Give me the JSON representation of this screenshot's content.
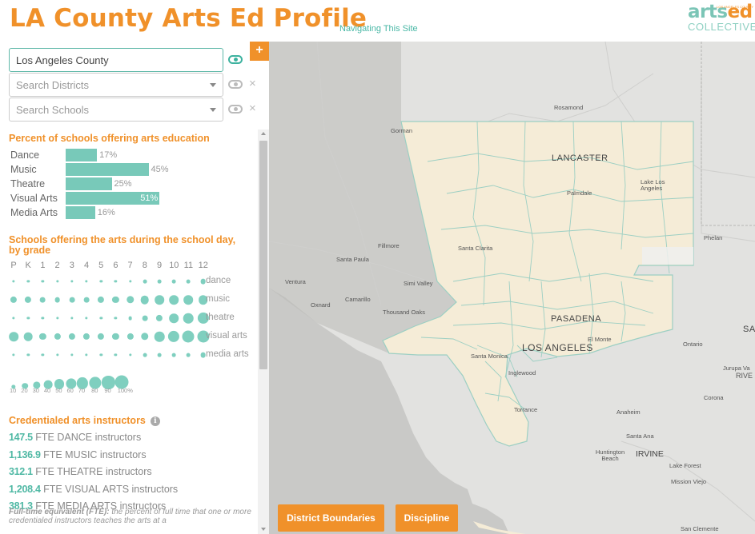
{
  "header": {
    "title": "LA County Arts Ed Profile",
    "nav_link": "Navigating This Site",
    "logo_main_1": "arts",
    "logo_main_2": "ed",
    "logo_sub": "COLLECTIVE",
    "logo_tiny": "LOS ANGELES COUNTY"
  },
  "search": {
    "county_value": "Los Angeles County",
    "districts_placeholder": "Search Districts",
    "schools_placeholder": "Search Schools",
    "add_label": "+",
    "clear_icon": "×"
  },
  "percent_section": {
    "title": "Percent of schools offering arts education",
    "rows": [
      {
        "label": "Dance",
        "value": "17%",
        "pct": 17
      },
      {
        "label": "Music",
        "value": "45%",
        "pct": 45
      },
      {
        "label": "Theatre",
        "value": "25%",
        "pct": 25
      },
      {
        "label": "Visual Arts",
        "value": "51%",
        "pct": 51
      },
      {
        "label": "Media Arts",
        "value": "16%",
        "pct": 16
      }
    ]
  },
  "grade_section": {
    "title_line1": "Schools offering the arts during the school day,",
    "title_line2": "by grade",
    "grades": [
      "P",
      "K",
      "1",
      "2",
      "3",
      "4",
      "5",
      "6",
      "7",
      "8",
      "9",
      "10",
      "11",
      "12"
    ],
    "disciplines": [
      {
        "label": "dance",
        "pct": [
          5,
          5,
          5,
          5,
          5,
          5,
          5,
          5,
          5,
          10,
          10,
          10,
          10,
          20
        ]
      },
      {
        "label": "music",
        "pct": [
          30,
          30,
          20,
          20,
          20,
          20,
          30,
          30,
          40,
          50,
          60,
          60,
          60,
          60
        ]
      },
      {
        "label": "theatre",
        "pct": [
          5,
          5,
          5,
          5,
          5,
          5,
          5,
          5,
          10,
          20,
          30,
          60,
          70,
          90
        ]
      },
      {
        "label": "visual arts",
        "pct": [
          60,
          50,
          30,
          30,
          30,
          30,
          30,
          30,
          30,
          40,
          70,
          90,
          100,
          100
        ]
      },
      {
        "label": "media arts",
        "pct": [
          5,
          5,
          5,
          5,
          5,
          5,
          5,
          5,
          5,
          10,
          10,
          10,
          10,
          20
        ]
      }
    ],
    "legend": [
      {
        "label": "10",
        "pct": 10
      },
      {
        "label": "20",
        "pct": 20
      },
      {
        "label": "30",
        "pct": 30
      },
      {
        "label": "40",
        "pct": 40
      },
      {
        "label": "50",
        "pct": 50
      },
      {
        "label": "60",
        "pct": 60
      },
      {
        "label": "70",
        "pct": 70
      },
      {
        "label": "80",
        "pct": 80
      },
      {
        "label": "90",
        "pct": 90
      },
      {
        "label": "100%",
        "pct": 100
      }
    ]
  },
  "instructors": {
    "title": "Credentialed arts instructors",
    "info_icon": "i",
    "rows": [
      {
        "num": "147.5",
        "text": "FTE DANCE instructors"
      },
      {
        "num": "1,136.9",
        "text": "FTE MUSIC instructors"
      },
      {
        "num": "312.1",
        "text": "FTE THEATRE instructors"
      },
      {
        "num": "1,208.4",
        "text": "FTE VISUAL ARTS instructors"
      },
      {
        "num": "381.3",
        "text": "FTE MEDIA ARTS instructors"
      }
    ],
    "note_bold": "Full-time equivalent (FTE):",
    "note_text": "the percent of full time that one or more credentialed instructors teaches the arts at a"
  },
  "map": {
    "labels": [
      "Rosamond",
      "Gorman",
      "LANCASTER",
      "Lake Los Angeles",
      "Palmdale",
      "Phelan",
      "Fillmore",
      "Santa Paula",
      "Santa Clarita",
      "Ventura",
      "Simi Valley",
      "Camarillo",
      "Oxnard",
      "Thousand Oaks",
      "PASADENA",
      "LOS ANGELES",
      "El Monte",
      "Ontario",
      "SA",
      "Santa Monica",
      "Inglewood",
      "Jurupa Va",
      "RIVE",
      "Corona",
      "Torrance",
      "Anaheim",
      "Santa Ana",
      "Huntington Beach",
      "IRVINE",
      "Lake Forest",
      "Mission Viejo",
      "San Clemente"
    ],
    "buttons": {
      "district": "District Boundaries",
      "discipline": "Discipline"
    },
    "colors": {
      "county_fill": "#f5ecd7",
      "district_line": "#9ccfc3",
      "water": "#c9c9c7",
      "land": "#e3e3e1"
    }
  }
}
